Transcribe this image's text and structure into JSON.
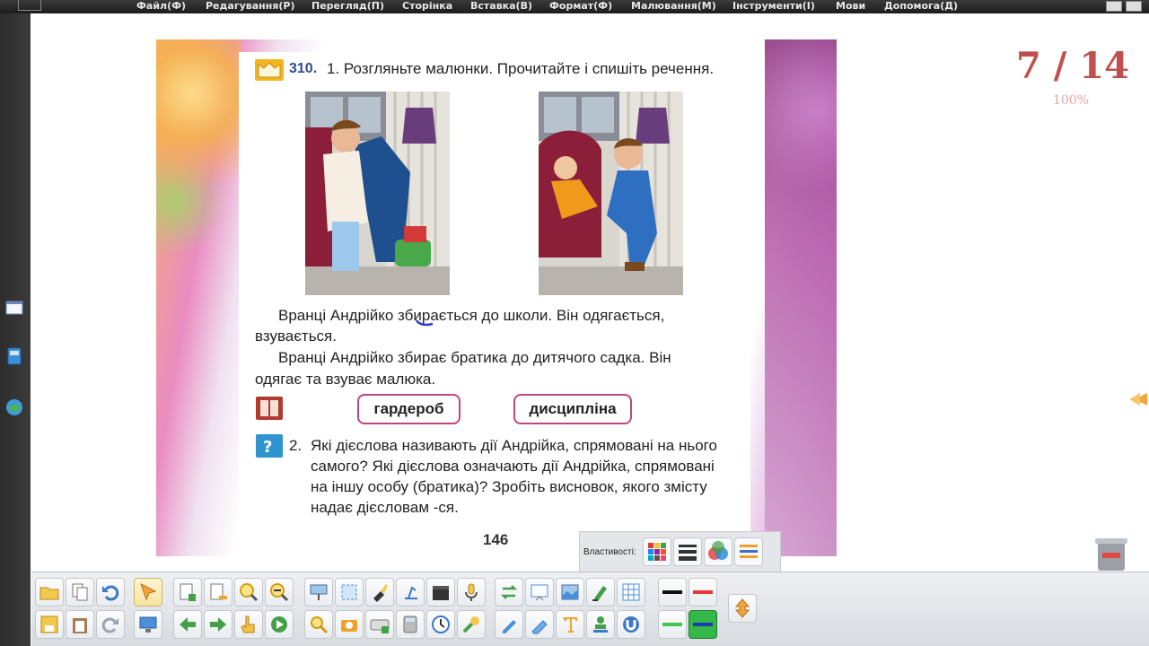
{
  "menu": {
    "items": [
      "Файл(Ф)",
      "Редагування(Р)",
      "Перегляд(П)",
      "Сторінка",
      "Вставка(В)",
      "Формат(Ф)",
      "Малювання(М)",
      "Інструменти(І)",
      "Мови",
      "Допомога(Д)"
    ]
  },
  "book": {
    "exercise_number": "310.",
    "instruction": "1. Розгляньте малюнки. Прочитайте і спишіть речення.",
    "paragraph1_line1": "Вранці Андрійко збирається до школи. Він одягається,",
    "paragraph1_line2": "взувається.",
    "paragraph2_line1": "Вранці Андрійко збирає братика до дитячого садка. Він",
    "paragraph2_line2": "одягає та взуває малюка.",
    "word1": "гардероб",
    "word2": "дисципліна",
    "task_number": "2.",
    "question_line1": "Які дієслова називають дії Андрійка, спрямовані на нього",
    "question_line2": "самого? Які дієслова означають дії Андрійка, спрямовані",
    "question_line3": "на іншу особу (братика)? Зробіть висновок, якого змісту",
    "question_line4": "надає дієсловам -ся.",
    "page_number": "146"
  },
  "viewer": {
    "page_counter": "7 / 14",
    "zoom_level": "100%"
  },
  "properties": {
    "label": "Властивості:"
  },
  "colors": {
    "counter": "#c0504d",
    "word_border": "#c2457f",
    "exercise_number": "#2c4b8e"
  }
}
